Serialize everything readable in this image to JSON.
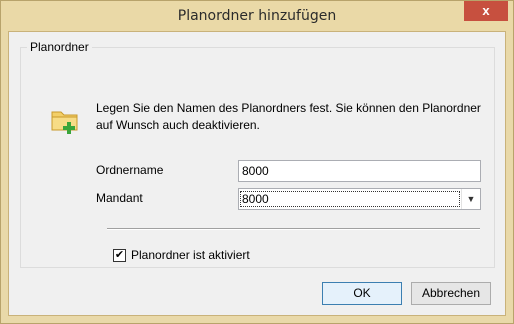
{
  "window": {
    "title": "Planordner hinzufügen",
    "close_label": "x"
  },
  "group": {
    "title": "Planordner"
  },
  "description": "Legen Sie den Namen des Planordners fest. Sie können den Planordner auf Wunsch auch deaktivieren.",
  "form": {
    "name_label": "Ordnername",
    "name_value": "8000",
    "client_label": "Mandant",
    "client_value": "8000",
    "active_label": "Planordner ist aktiviert",
    "active_checked": true,
    "check_glyph": "✔"
  },
  "buttons": {
    "ok": "OK",
    "cancel": "Abbrechen"
  },
  "icons": {
    "folder": "folder-add-icon",
    "dropdown": "chevron-down-icon"
  },
  "colors": {
    "frame": "#e9d9a9",
    "close": "#c7503f",
    "plus": "#3aa53a",
    "folder": "#f3cf68"
  }
}
